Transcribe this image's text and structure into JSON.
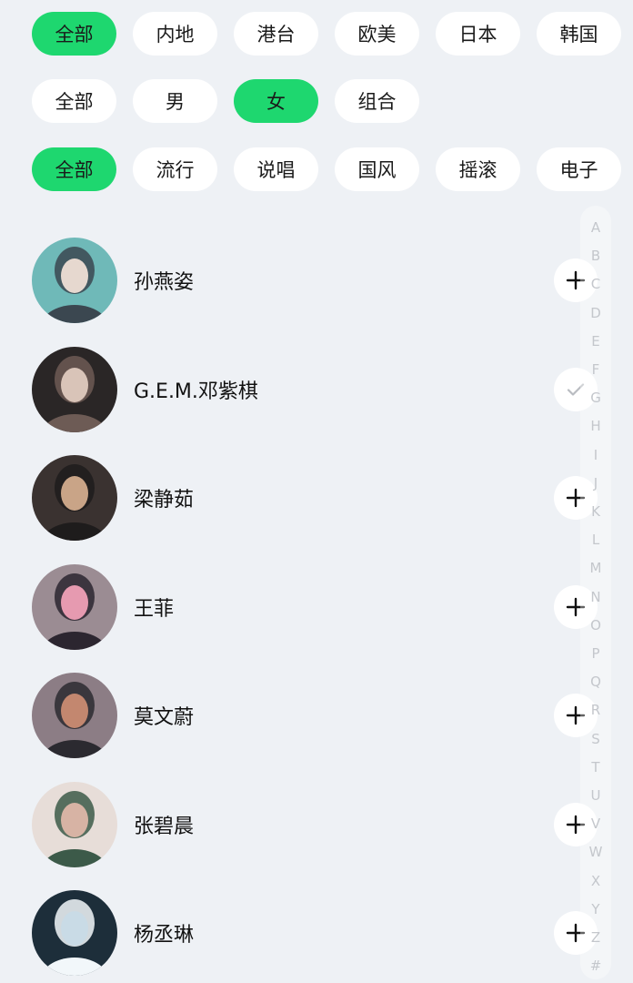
{
  "filters": {
    "region": [
      {
        "label": "全部",
        "active": true
      },
      {
        "label": "内地",
        "active": false
      },
      {
        "label": "港台",
        "active": false
      },
      {
        "label": "欧美",
        "active": false
      },
      {
        "label": "日本",
        "active": false
      },
      {
        "label": "韩国",
        "active": false
      }
    ],
    "gender": [
      {
        "label": "全部",
        "active": false
      },
      {
        "label": "男",
        "active": false
      },
      {
        "label": "女",
        "active": true
      },
      {
        "label": "组合",
        "active": false
      }
    ],
    "genre": [
      {
        "label": "全部",
        "active": true
      },
      {
        "label": "流行",
        "active": false
      },
      {
        "label": "说唱",
        "active": false
      },
      {
        "label": "国风",
        "active": false
      },
      {
        "label": "摇滚",
        "active": false
      },
      {
        "label": "电子",
        "active": false
      }
    ]
  },
  "artists": [
    {
      "name": "孙燕姿",
      "followed": false,
      "palette": [
        "#6fb9b8",
        "#e6d8cf",
        "#3b4750"
      ]
    },
    {
      "name": "G.E.M.邓紫棋",
      "followed": true,
      "palette": [
        "#2a2626",
        "#d9c4b8",
        "#6d5b55"
      ]
    },
    {
      "name": "梁静茹",
      "followed": false,
      "palette": [
        "#3a3230",
        "#c9a487",
        "#1e1c1c"
      ]
    },
    {
      "name": "王菲",
      "followed": false,
      "palette": [
        "#9b8c93",
        "#e69ab0",
        "#2c2630"
      ]
    },
    {
      "name": "莫文蔚",
      "followed": false,
      "palette": [
        "#8c7d85",
        "#c3876f",
        "#2b2a30"
      ]
    },
    {
      "name": "张碧晨",
      "followed": false,
      "palette": [
        "#e7ddd8",
        "#d7b3a4",
        "#3c5a49"
      ]
    },
    {
      "name": "杨丞琳",
      "followed": false,
      "palette": [
        "#1d2e3a",
        "#c9dbe6",
        "#f2f7fa"
      ]
    }
  ],
  "alpha_index": [
    "A",
    "B",
    "C",
    "D",
    "E",
    "F",
    "G",
    "H",
    "I",
    "J",
    "K",
    "L",
    "M",
    "N",
    "O",
    "P",
    "Q",
    "R",
    "S",
    "T",
    "U",
    "V",
    "W",
    "X",
    "Y",
    "Z",
    "#"
  ],
  "colors": {
    "background": "#eef1f5",
    "accent": "#1ed76f",
    "chip": "#ffffff",
    "index_letter": "#c4c7cc"
  },
  "icons": {
    "follow": "plus-icon",
    "followed": "check-icon"
  }
}
